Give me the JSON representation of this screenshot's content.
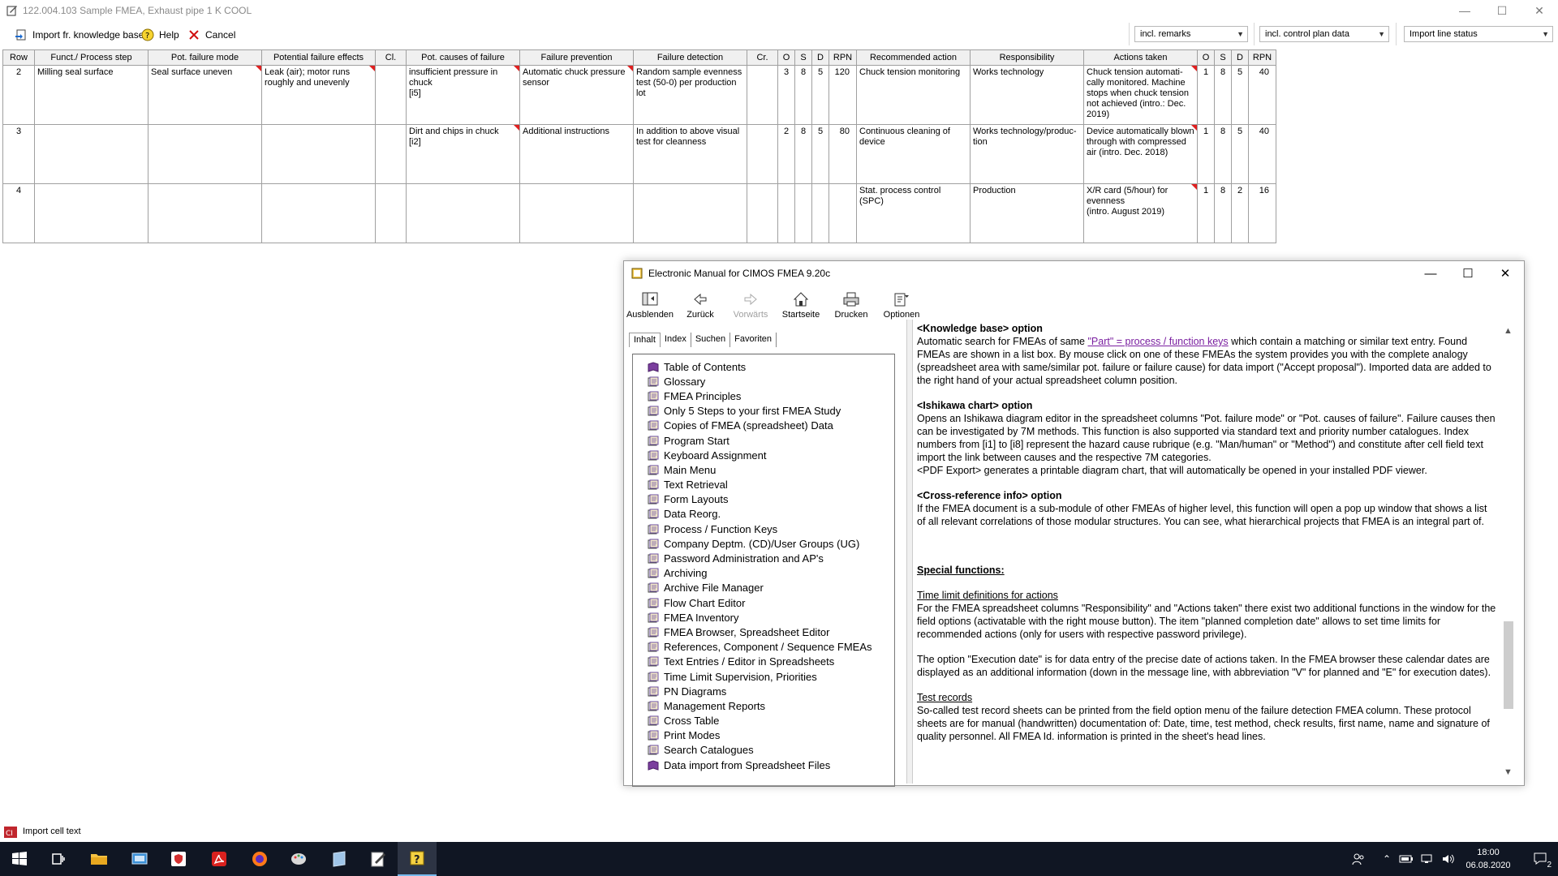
{
  "window": {
    "title": "122.004.103  Sample FMEA, Exhaust pipe  1  K  COOL"
  },
  "toolbar": {
    "import_label": "Import fr. knowledge base",
    "help_label": "Help",
    "cancel_label": "Cancel",
    "combo1": "incl. remarks",
    "combo2": "incl. control plan data",
    "combo3": "Import line status"
  },
  "sheet": {
    "headers": [
      "Row",
      "Funct./ Process step",
      "Pot. failure mode",
      "Potential failure effects",
      "Cl.",
      "Pot. causes of failure",
      "Failure prevention",
      "Failure detection",
      "Cr.",
      "O",
      "S",
      "D",
      "RPN",
      "Recommended action",
      "Responsibility",
      "Actions taken",
      "O",
      "S",
      "D",
      "RPN"
    ],
    "rows": [
      {
        "row": "2",
        "funct": "Milling seal surface",
        "mode": "Seal surface uneven",
        "effects": "Leak (air); motor runs roughly and unevenly",
        "cl": "",
        "causes": "insufficient pressure in chuck\n[i5]",
        "prevention": "Automatic chuck pressure sensor",
        "detection": "Random sample evenness test (50-0) per production lot",
        "cr": "",
        "o": "3",
        "s": "8",
        "d": "5",
        "rpn": "120",
        "recommended": "Chuck tension monitoring",
        "responsibility": "Works technology",
        "taken": "Chuck tension automati-cally monitored. Machine stops when chuck tension not achieved (intro.: Dec. 2019)",
        "o2": "1",
        "s2": "8",
        "d2": "5",
        "rpn2": "40"
      },
      {
        "row": "3",
        "funct": "",
        "mode": "",
        "effects": "",
        "cl": "",
        "causes": "Dirt and chips in chuck\n[i2]",
        "prevention": "Additional instructions",
        "detection": "In addition to above visual test for cleanness",
        "cr": "",
        "o": "2",
        "s": "8",
        "d": "5",
        "rpn": "80",
        "recommended": "Continuous cleaning of device",
        "responsibility": "Works technology/produc-tion",
        "taken": "Device automatically blown through with compressed air (intro. Dec. 2018)",
        "o2": "1",
        "s2": "8",
        "d2": "5",
        "rpn2": "40"
      },
      {
        "row": "4",
        "funct": "",
        "mode": "",
        "effects": "",
        "cl": "",
        "causes": "",
        "prevention": "",
        "detection": "",
        "cr": "",
        "o": "",
        "s": "",
        "d": "",
        "rpn": "",
        "recommended": "Stat. process control (SPC)",
        "responsibility": "Production",
        "taken": "X/R card (5/hour) for evenness\n(intro. August 2019)",
        "o2": "1",
        "s2": "8",
        "d2": "2",
        "rpn2": "16"
      }
    ]
  },
  "help": {
    "title": "Electronic Manual for CIMOS FMEA 9.20c",
    "buttons": [
      "Ausblenden",
      "Zurück",
      "Vorwärts",
      "Startseite",
      "Drucken",
      "Optionen"
    ],
    "tabs": [
      "Inhalt",
      "Index",
      "Suchen",
      "Favoriten"
    ],
    "toc": [
      "Table of Contents",
      "Glossary",
      "FMEA Principles",
      "Only 5 Steps to your first FMEA Study",
      "Copies of FMEA (spreadsheet) Data",
      "Program Start",
      "Keyboard Assignment",
      "Main Menu",
      "Text Retrieval",
      "Form Layouts",
      "Data Reorg.",
      "Process / Function Keys",
      "Company Deptm. (CD)/User Groups (UG)",
      "Password Administration and AP's",
      "Archiving",
      "Archive File Manager",
      "Flow Chart Editor",
      "FMEA Inventory",
      "FMEA Browser, Spreadsheet Editor",
      "References, Component / Sequence FMEAs",
      "Text Entries / Editor in Spreadsheets",
      "Time Limit Supervision, Priorities",
      "PN  Diagrams",
      "Management Reports",
      "Cross Table",
      "Print Modes",
      "Search Catalogues",
      "Data import from Spreadsheet Files"
    ],
    "kb_heading": "<Knowledge base> option",
    "kb_text1": "Automatic search for FMEAs of same ",
    "kb_link": "\"Part\" = process / function keys",
    "kb_text2": " which contain a matching or similar text entry. Found FMEAs are shown in a list box. By mouse click on one of these FMEAs the system provides you with the complete analogy (spreadsheet area with same/similar pot. failure or failure cause) for data import (\"Accept proposal\"). Imported data are added to the right hand of your actual spreadsheet column position.",
    "ish_heading": "<Ishikawa chart> option",
    "ish_text": "Opens an Ishikawa diagram editor in the spreadsheet columns \"Pot. failure mode\" or \"Pot. causes of failure\". Failure causes then can be investigated by 7M methods. This function is also supported via standard text and priority number catalogues. Index numbers from [i1] to [i8] represent the hazard cause rubrique (e.g. \"Man/human\" or \"Method\") and constitute after cell field text import the link between causes and the respective 7M categories.",
    "ish_text2": "<PDF Export> generates a printable diagram chart, that will automatically be opened in your installed PDF viewer.",
    "xref_heading": "<Cross-reference info> option",
    "xref_text": "If the FMEA document is a sub-module of other FMEAs of higher level, this function will open a pop up window that shows a list of all relevant correlations of those modular structures. You can see, what hierarchical projects that FMEA is an integral part of.",
    "special_heading": "Special functions:",
    "tl_heading": "Time limit definitions for actions",
    "tl_text": "For the FMEA spreadsheet columns \"Responsibility\" and \"Actions taken\" there exist two additional functions in the window for the field options (activatable with the right mouse button). The item \"planned completion date\" allows to set time limits for recommended actions (only for users with respective password privilege).",
    "tl_text2": "The option \"Execution date\" is for data entry of the precise date of actions taken. In the FMEA browser these calendar dates are displayed as an additional information (down in the message line, with abbreviation \"V\" for planned and \"E\" for execution dates).",
    "tr_heading": "Test records",
    "tr_text": "So-called test record sheets can be printed from the field option menu of the failure detection FMEA column. These protocol sheets are for manual (handwritten) documentation of: Date, time, test method, check results, first name, name and signature of quality personnel. All FMEA Id. information is printed in the sheet's head lines."
  },
  "status": {
    "text": "Import cell text"
  },
  "clock": {
    "time": "18:00",
    "date": "06.08.2020"
  },
  "notification_count": "2",
  "colors": {
    "flag": "#e02020",
    "link": "#7a1fa0",
    "taskbar": "#101623"
  }
}
